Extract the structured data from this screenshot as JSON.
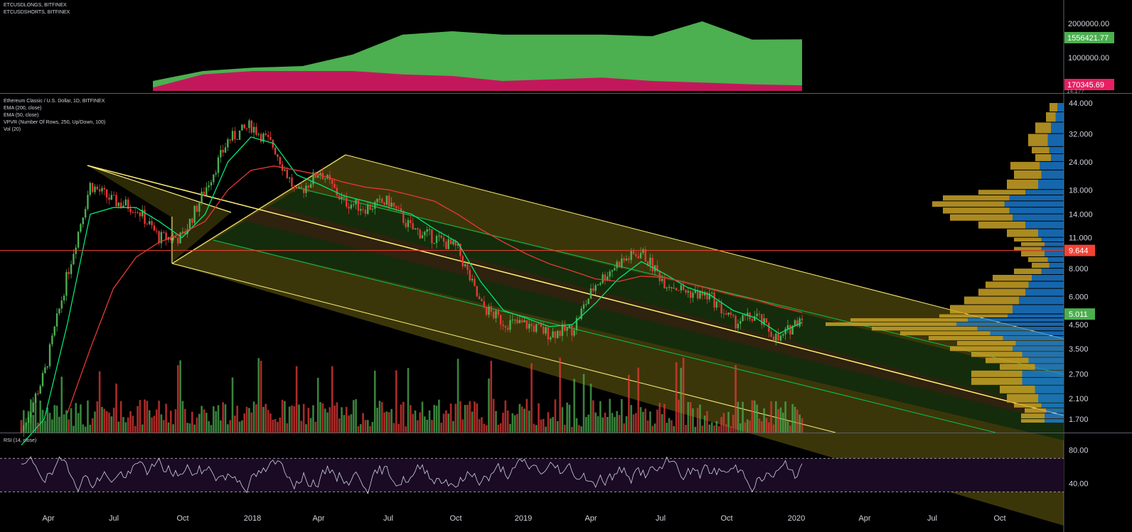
{
  "top_pane": {
    "legend": [
      "ETCUSDLONGS, BITFINEX",
      "ETCUSDSHORTS, BITFINEX"
    ],
    "scale_labels": [
      "2000000.00",
      "1000000.00"
    ],
    "longs_badge": "1556421.77",
    "shorts_badge": "170345.69",
    "clipped_label": "14.1??",
    "colors": {
      "longs": "#4caf50",
      "shorts": "#c2185b",
      "longs_badge": "#4caf50",
      "shorts_badge": "#e91e63"
    }
  },
  "main_pane": {
    "legend": [
      "Ethereum Classic / U.S. Dollar, 1D, BITFINEX",
      "EMA (200, close)",
      "EMA (50, close)",
      "VPVR (Number Of Rows, 250, Up/Down, 100)",
      "Vol (20)"
    ],
    "price_scale": [
      "44.000",
      "32.000",
      "24.000",
      "18.000",
      "14.000",
      "11.000",
      "8.000",
      "6.000",
      "4.500",
      "3.500",
      "2.700",
      "2.100",
      "1.700"
    ],
    "last_price_badge": "5.011",
    "horizontal_line_badge": "9.644",
    "colors": {
      "up": "#26a69a",
      "candle_up": "#4caf50",
      "candle_down": "#e53935",
      "ema200": "#e53935",
      "ema50": "#00e676",
      "channel_line": "#fff176",
      "channel_fill": "#827717",
      "horizontal_line": "#f44336",
      "vpvr_up": "#1e88e5",
      "vpvr_down": "#c9a227"
    }
  },
  "rsi_pane": {
    "legend": "RSI (14, close)",
    "scale_labels": [
      "80.00",
      "40.00"
    ],
    "colors": {
      "line": "#d1d4dc",
      "band": "#1a0a24"
    }
  },
  "time_axis": [
    "Apr",
    "Jul",
    "Oct",
    "2018",
    "Apr",
    "Jul",
    "Oct",
    "2019",
    "Apr",
    "Jul",
    "Oct",
    "2020",
    "Apr",
    "Jul",
    "Oct"
  ],
  "chart_data": [
    {
      "type": "area",
      "title": "ETCUSDLONGS, BITFINEX / ETCUSDSHORTS, BITFINEX",
      "x": [
        "2017-05",
        "2017-08",
        "2017-11",
        "2018-02",
        "2018-03",
        "2018-05",
        "2018-08",
        "2018-11",
        "2019-02",
        "2019-05",
        "2019-08",
        "2019-09",
        "2019-11",
        "2020-01"
      ],
      "series": [
        {
          "name": "ETCUSDLONGS, BITFINEX",
          "values": [
            300000,
            600000,
            700000,
            750000,
            1100000,
            1700000,
            1800000,
            1700000,
            1700000,
            1700000,
            1650000,
            2100000,
            1550000,
            1556421.77
          ]
        },
        {
          "name": "ETCUSDSHORTS, BITFINEX",
          "values": [
            100000,
            500000,
            600000,
            600000,
            600000,
            500000,
            450000,
            300000,
            350000,
            400000,
            300000,
            250000,
            200000,
            170345.69
          ]
        }
      ],
      "ylim": [
        0,
        2400000
      ]
    },
    {
      "type": "line",
      "title": "Ethereum Classic / U.S. Dollar, 1D, BITFINEX",
      "log_scale": true,
      "x": [
        "2017-03",
        "2017-04",
        "2017-05",
        "2017-06",
        "2017-07",
        "2017-08",
        "2017-09",
        "2017-10",
        "2017-11",
        "2017-12",
        "2018-01",
        "2018-02",
        "2018-03",
        "2018-04",
        "2018-05",
        "2018-06",
        "2018-07",
        "2018-08",
        "2018-09",
        "2018-10",
        "2018-11",
        "2018-12",
        "2019-01",
        "2019-02",
        "2019-03",
        "2019-04",
        "2019-05",
        "2019-06",
        "2019-07",
        "2019-08",
        "2019-09",
        "2019-10",
        "2019-11",
        "2019-12",
        "2020-01"
      ],
      "series": [
        {
          "name": "Ethereum Classic / U.S. Dollar, 1D, BITFINEX",
          "values": [
            1.5,
            2.7,
            7.5,
            19,
            16,
            15,
            11,
            11,
            18,
            30,
            35,
            28,
            17,
            22,
            16,
            15,
            16,
            12,
            11,
            9.8,
            5.5,
            4.6,
            4.5,
            4.1,
            4.3,
            6.8,
            8.5,
            9.5,
            7.0,
            6.3,
            6.0,
            4.6,
            4.9,
            3.8,
            5.0
          ]
        },
        {
          "name": "EMA (50, close)",
          "values": [
            1.3,
            1.7,
            4.5,
            14,
            15,
            15,
            13,
            11,
            14,
            24,
            31,
            29,
            21,
            19,
            17,
            16,
            15,
            14,
            12,
            10.5,
            7.0,
            5.2,
            4.8,
            4.4,
            4.5,
            5.6,
            7.2,
            8.6,
            7.6,
            6.6,
            6.1,
            5.2,
            4.8,
            4.1,
            4.6
          ]
        },
        {
          "name": "EMA (200, close)",
          "values": [
            null,
            null,
            1.8,
            3.5,
            6.5,
            9.0,
            10.5,
            11.5,
            13,
            18,
            22,
            23,
            22,
            21,
            19.5,
            18.5,
            18,
            17,
            16,
            14,
            12,
            10.5,
            9.3,
            8.4,
            7.8,
            7.2,
            7.0,
            7.4,
            7.3,
            6.9,
            6.5,
            6.1,
            5.8,
            5.4,
            5.1
          ]
        }
      ],
      "horizontal_line": 9.644,
      "last_price": 5.011,
      "ylim": [
        1.5,
        46
      ]
    },
    {
      "type": "line",
      "title": "RSI (14, close)",
      "ylim": [
        10,
        100
      ],
      "bands": [
        30,
        70
      ]
    }
  ]
}
